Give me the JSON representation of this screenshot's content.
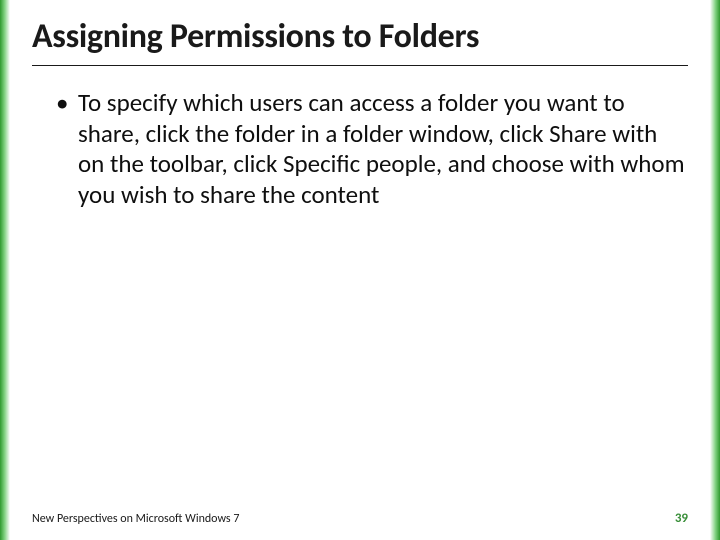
{
  "slide": {
    "title": "Assigning Permissions to Folders",
    "bullets": [
      "To specify which users can access a folder you want to share, click the folder in a folder window, click Share with on the toolbar, click Specific people, and choose with whom you wish to share the content"
    ],
    "footer": {
      "source": "New Perspectives on Microsoft Windows 7",
      "page": "39"
    }
  },
  "colors": {
    "accent_green": "#3a8f3a",
    "edge_green_dark": "#2e9a2e",
    "edge_green_light": "#7fd17f"
  }
}
